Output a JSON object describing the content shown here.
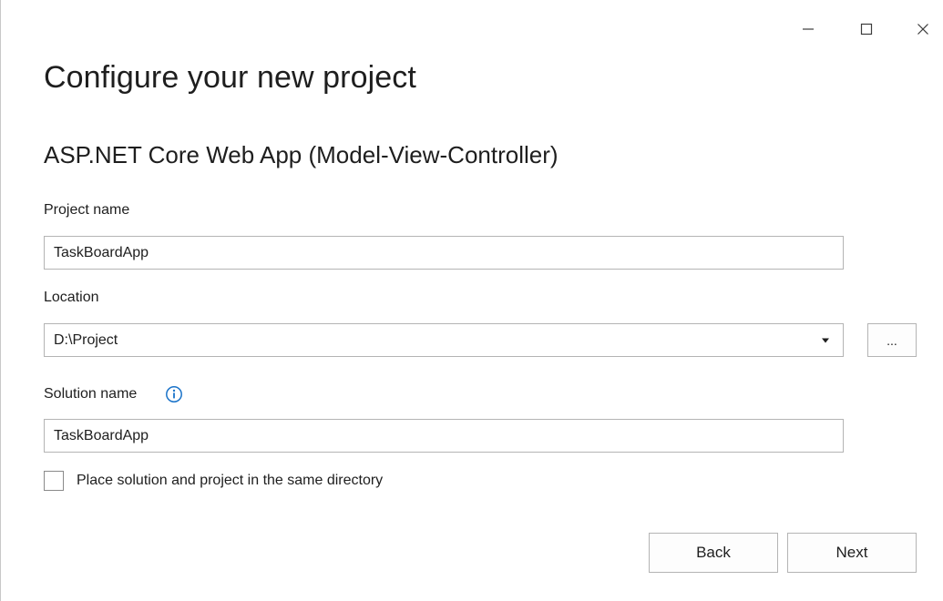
{
  "window": {
    "minimize_glyph": "minimize-icon",
    "maximize_glyph": "maximize-icon",
    "close_glyph": "close-icon"
  },
  "header": {
    "title": "Configure your new project",
    "template_name": "ASP.NET Core Web App (Model-View-Controller)"
  },
  "form": {
    "project_name": {
      "label": "Project name",
      "value": "TaskBoardApp"
    },
    "location": {
      "label": "Location",
      "value": "D:\\Project",
      "browse_label": "..."
    },
    "solution_name": {
      "label": "Solution name",
      "value": "TaskBoardApp",
      "info_icon": "info-icon"
    },
    "same_directory": {
      "label": "Place solution and project in the same directory",
      "checked": false
    }
  },
  "footer": {
    "back_label": "Back",
    "next_label": "Next"
  },
  "colors": {
    "info_accent": "#1a73c9",
    "border": "#b4b4b4",
    "text": "#1e1e1e"
  }
}
